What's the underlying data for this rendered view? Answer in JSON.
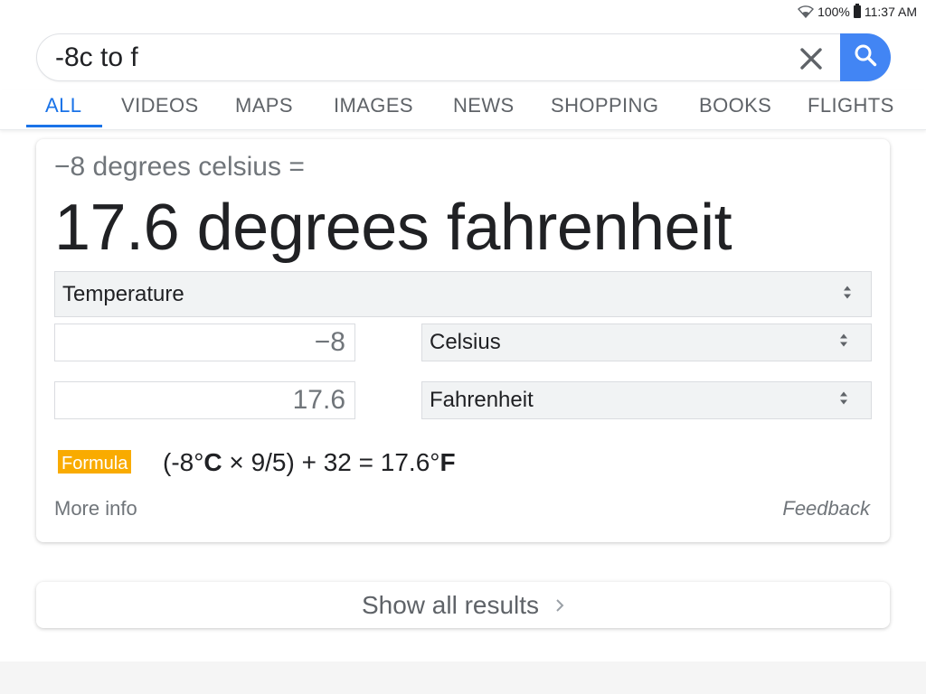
{
  "status_bar": {
    "battery": "100%",
    "time": "11:37 AM"
  },
  "search": {
    "query": "-8c to f"
  },
  "tabs": [
    {
      "label": "ALL",
      "active": true
    },
    {
      "label": "VIDEOS"
    },
    {
      "label": "MAPS"
    },
    {
      "label": "IMAGES"
    },
    {
      "label": "NEWS"
    },
    {
      "label": "SHOPPING"
    },
    {
      "label": "BOOKS"
    },
    {
      "label": "FLIGHTS"
    }
  ],
  "converter": {
    "expression": "−8 degrees celsius =",
    "result": "17.6 degrees fahrenheit",
    "unit_type": "Temperature",
    "from_value": "−8",
    "from_unit": "Celsius",
    "to_value": "17.6",
    "to_unit": "Fahrenheit",
    "formula_label": "Formula",
    "formula_part1": "(-8°",
    "formula_bold1": "C",
    "formula_part2": " × 9/5) + 32 = 17.6°",
    "formula_bold2": "F",
    "more_info": "More info",
    "feedback": "Feedback"
  },
  "show_all": {
    "label": "Show all results"
  },
  "colors": {
    "accent": "#1a73e8",
    "search_button": "#4285f4",
    "formula_badge": "#f9ab00"
  }
}
